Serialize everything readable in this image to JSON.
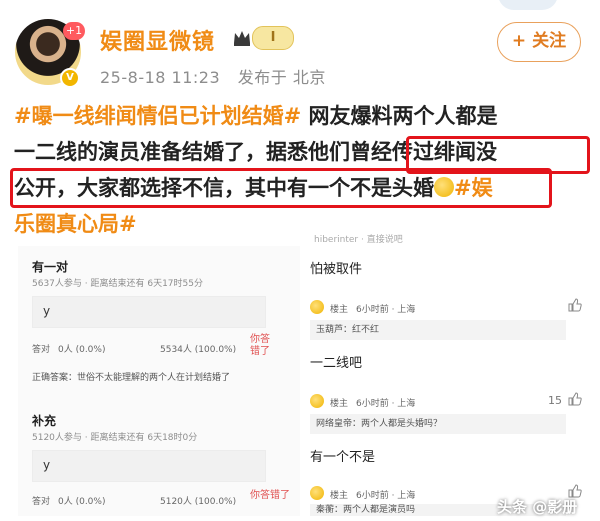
{
  "header": {
    "user_name": "娱圈显微镜",
    "avatar_badge": "+1",
    "vip_level": "I",
    "post_time": "25-8-18 11:23",
    "post_location": "发布于 北京",
    "follow_label": "+ 关注"
  },
  "post": {
    "hashtag1": "#曝一线绯闻情侣已计划结婚#",
    "line1_rest": " 网友爆料两个人都是",
    "line2_a": "一二线的演员准备结婚了，据悉他们",
    "line2_b": "曾经传过绯闻没",
    "line3_a": "公开，大家都选择不信，其中有一个不是头婚",
    "hashtag2_a": "#娱",
    "hashtag2_b": "乐圈真心局#"
  },
  "poll": {
    "section1_title": "有一对",
    "section1_meta": "5637人参与 · 距离结束还有 6天17时55分",
    "section1_option": "y",
    "section1_answered_label": "答对",
    "section1_answered": "0人 (0.0%)",
    "section1_total": "5534人 (100.0%)",
    "section1_wrong": "你答错了",
    "section1_answer": "正确答案：世俗不太能理解的两个人在计划结婚了",
    "section2_title": "补充",
    "section2_meta": "5120人参与 · 距离结束还有 6天18时0分",
    "section2_option": "y",
    "section2_answered_label": "答对",
    "section2_answered": "0人 (0.0%)",
    "section2_total": "5120人 (100.0%)",
    "section2_wrong": "你答错了"
  },
  "comments": {
    "top_faded": "hiberinter · 直接说吧",
    "c1_text": "怕被取件",
    "c1_user": "楼主",
    "c1_time": "6小时前 · 上海",
    "c1_sub": "玉葫芦：红不红",
    "c2_text": "一二线吧",
    "c2_user": "楼主",
    "c2_time": "6小时前 · 上海",
    "c2_likes": "15",
    "c2_sub": "网络皇帝：两个人都是头婚吗？",
    "c3_text": "有一个不是",
    "c3_user": "楼主",
    "c3_time": "6小时前 · 上海",
    "c3_sub": "秦蘅：两个人都是演员吗"
  },
  "watermark": "头条 @影册",
  "colors": {
    "accent_orange": "#f08b15",
    "highlight_red": "#e3141b",
    "meta_gray": "#8d8d8d"
  }
}
